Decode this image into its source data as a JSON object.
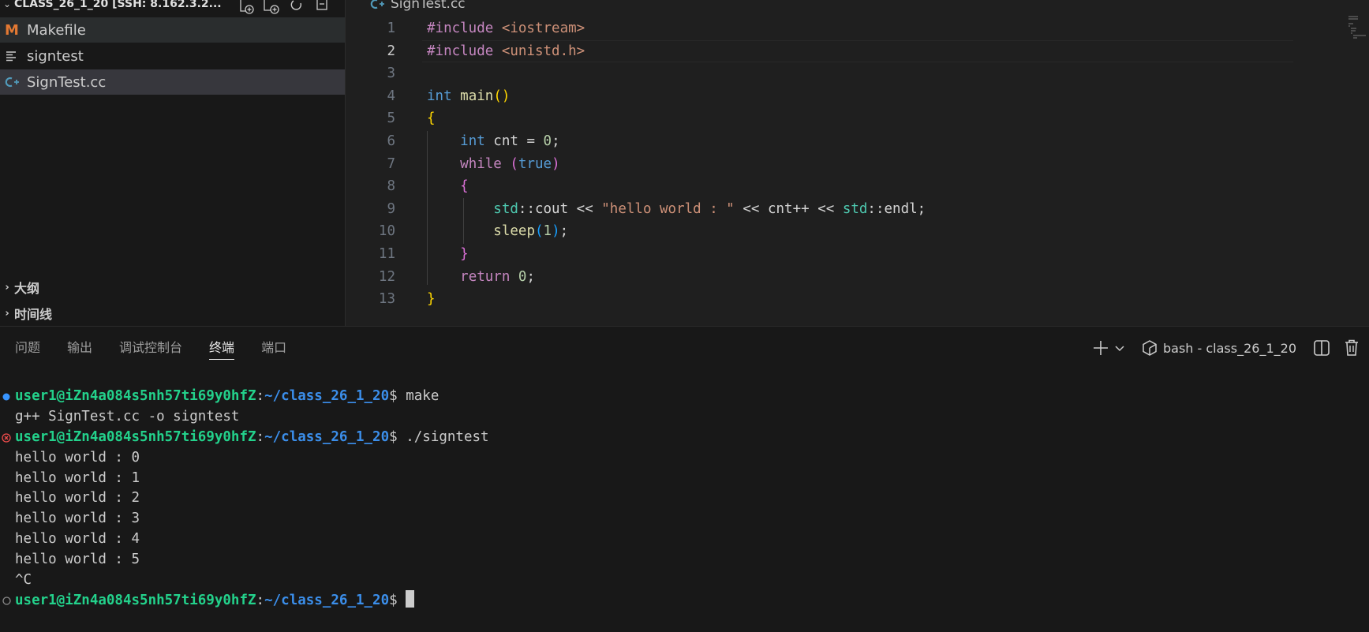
{
  "explorer": {
    "workspace_title": "CLASS_26_1_20 [SSH: 8.162.3.2...",
    "files": [
      {
        "name": "Makefile",
        "icon": "makefile-icon",
        "icon_glyph": "M"
      },
      {
        "name": "signtest",
        "icon": "text-file-icon"
      },
      {
        "name": "SignTest.cc",
        "icon": "cpp-file-icon"
      }
    ],
    "sections": [
      {
        "label": "大纲"
      },
      {
        "label": "时间线"
      }
    ]
  },
  "editor": {
    "tab_title": "SignTest.cc",
    "current_line": 2,
    "lines": [
      {
        "n": "1",
        "tokens": [
          {
            "t": "#include ",
            "c": "ctl"
          },
          {
            "t": "<iostream>",
            "c": "inc"
          }
        ]
      },
      {
        "n": "2",
        "tokens": [
          {
            "t": "#include ",
            "c": "ctl"
          },
          {
            "t": "<unistd.h>",
            "c": "inc"
          }
        ]
      },
      {
        "n": "3",
        "tokens": []
      },
      {
        "n": "4",
        "tokens": [
          {
            "t": "int",
            "c": "kw"
          },
          {
            "t": " ",
            "c": "id"
          },
          {
            "t": "main",
            "c": "fn"
          },
          {
            "t": "()",
            "c": "p1"
          }
        ]
      },
      {
        "n": "5",
        "tokens": [
          {
            "t": "{",
            "c": "p1"
          }
        ]
      },
      {
        "n": "6",
        "tokens": [
          {
            "t": "    ",
            "c": "id"
          },
          {
            "t": "int",
            "c": "kw"
          },
          {
            "t": " cnt = ",
            "c": "id"
          },
          {
            "t": "0",
            "c": "num"
          },
          {
            "t": ";",
            "c": "id"
          }
        ]
      },
      {
        "n": "7",
        "tokens": [
          {
            "t": "    ",
            "c": "id"
          },
          {
            "t": "while",
            "c": "ctl"
          },
          {
            "t": " ",
            "c": "id"
          },
          {
            "t": "(",
            "c": "p2"
          },
          {
            "t": "true",
            "c": "kw"
          },
          {
            "t": ")",
            "c": "p2"
          }
        ]
      },
      {
        "n": "8",
        "tokens": [
          {
            "t": "    ",
            "c": "id"
          },
          {
            "t": "{",
            "c": "p2"
          }
        ]
      },
      {
        "n": "9",
        "tokens": [
          {
            "t": "        ",
            "c": "id"
          },
          {
            "t": "std",
            "c": "ns"
          },
          {
            "t": "::cout << ",
            "c": "id"
          },
          {
            "t": "\"hello world : \"",
            "c": "str"
          },
          {
            "t": " << cnt++ << ",
            "c": "id"
          },
          {
            "t": "std",
            "c": "ns"
          },
          {
            "t": "::endl;",
            "c": "id"
          }
        ]
      },
      {
        "n": "10",
        "tokens": [
          {
            "t": "        ",
            "c": "id"
          },
          {
            "t": "sleep",
            "c": "fn"
          },
          {
            "t": "(",
            "c": "p3"
          },
          {
            "t": "1",
            "c": "num"
          },
          {
            "t": ")",
            "c": "p3"
          },
          {
            "t": ";",
            "c": "id"
          }
        ]
      },
      {
        "n": "11",
        "tokens": [
          {
            "t": "    ",
            "c": "id"
          },
          {
            "t": "}",
            "c": "p2"
          }
        ]
      },
      {
        "n": "12",
        "tokens": [
          {
            "t": "    ",
            "c": "id"
          },
          {
            "t": "return",
            "c": "ctl"
          },
          {
            "t": " ",
            "c": "id"
          },
          {
            "t": "0",
            "c": "num"
          },
          {
            "t": ";",
            "c": "id"
          }
        ]
      },
      {
        "n": "13",
        "tokens": [
          {
            "t": "}",
            "c": "p1"
          }
        ]
      }
    ]
  },
  "panel": {
    "tabs": [
      {
        "label": "问题",
        "active": false
      },
      {
        "label": "输出",
        "active": false
      },
      {
        "label": "调试控制台",
        "active": false
      },
      {
        "label": "终端",
        "active": true
      },
      {
        "label": "端口",
        "active": false
      }
    ],
    "terminal_label": "bash - class_26_1_20",
    "colors": {
      "user": "#23d18b",
      "path": "#3b8eea",
      "deco_ok": "#3794ff",
      "deco_err": "#f14c4c",
      "deco_idle": "#8b8b8b"
    },
    "terminal": [
      {
        "type": "prompt",
        "deco": "ok",
        "user": "user1@iZn4a084s5nh57ti69y0hfZ",
        "sep": ":",
        "path": "~/class_26_1_20",
        "cmd": "$ make"
      },
      {
        "type": "out",
        "text": "g++ SignTest.cc -o signtest"
      },
      {
        "type": "prompt",
        "deco": "err",
        "user": "user1@iZn4a084s5nh57ti69y0hfZ",
        "sep": ":",
        "path": "~/class_26_1_20",
        "cmd": "$ ./signtest"
      },
      {
        "type": "out",
        "text": "hello world : 0"
      },
      {
        "type": "out",
        "text": "hello world : 1"
      },
      {
        "type": "out",
        "text": "hello world : 2"
      },
      {
        "type": "out",
        "text": "hello world : 3"
      },
      {
        "type": "out",
        "text": "hello world : 4"
      },
      {
        "type": "out",
        "text": "hello world : 5"
      },
      {
        "type": "out",
        "text": "^C"
      },
      {
        "type": "prompt",
        "deco": "idle",
        "user": "user1@iZn4a084s5nh57ti69y0hfZ",
        "sep": ":",
        "path": "~/class_26_1_20",
        "cmd": "$ ",
        "cursor": true
      }
    ]
  }
}
